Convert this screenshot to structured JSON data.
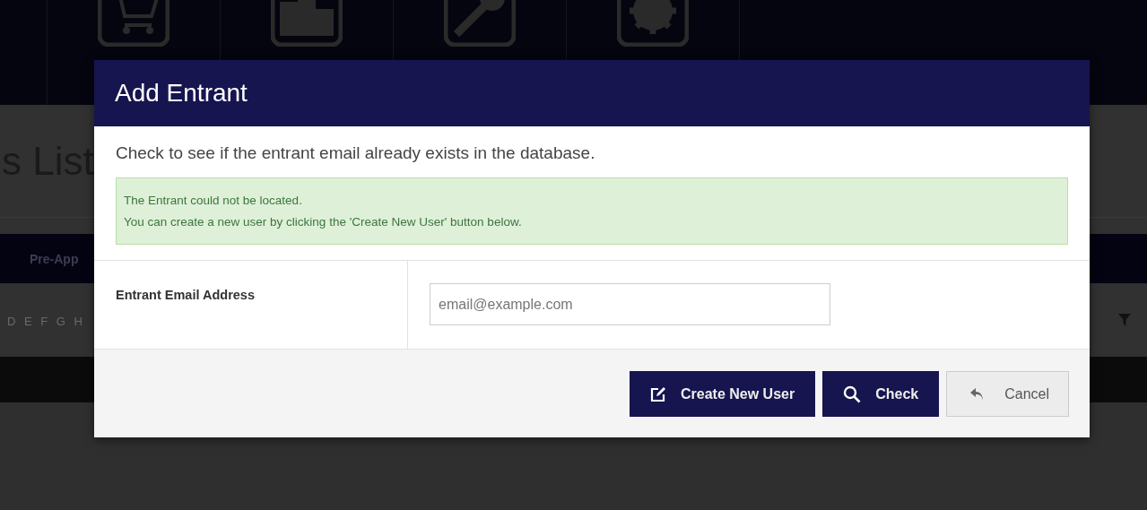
{
  "background": {
    "page_title": "s List",
    "tab_label": "Pre-App",
    "letter_filter": "D E F G H"
  },
  "dialog": {
    "title": "Add Entrant",
    "instruction": "Check to see if the entrant email already exists in the database.",
    "alert": {
      "kind": "success",
      "lines": [
        "The Entrant could not be located.",
        "You can create a new user by clicking the 'Create New User' button below."
      ]
    },
    "field": {
      "label": "Entrant Email Address",
      "placeholder": "email@example.com"
    },
    "buttons": [
      {
        "label": "Create New User",
        "kind": "primary"
      },
      {
        "label": "Check",
        "kind": "primary"
      },
      {
        "label": "Cancel",
        "kind": "default"
      }
    ]
  }
}
